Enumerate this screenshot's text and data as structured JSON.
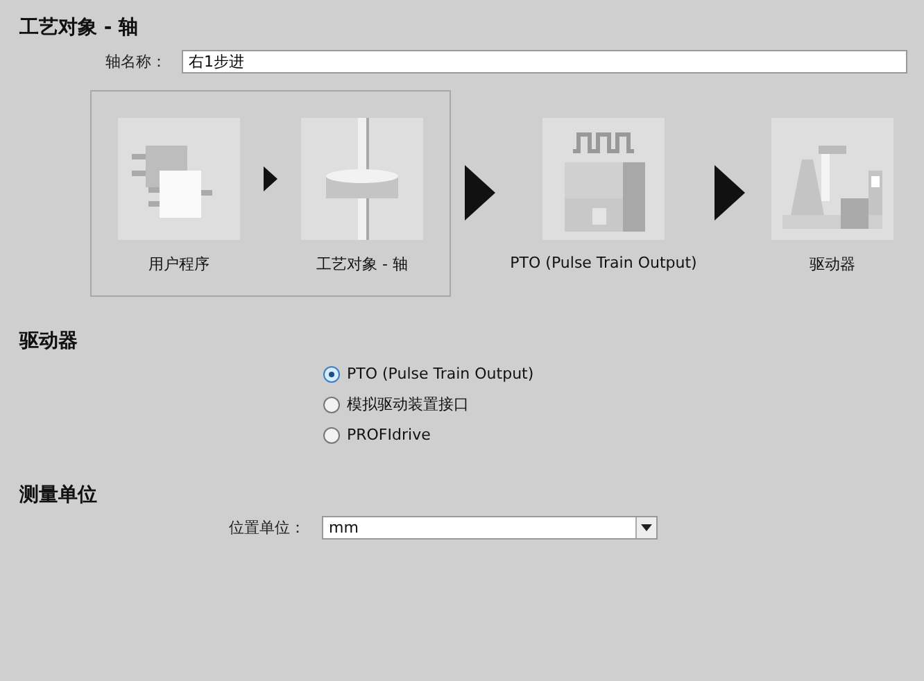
{
  "title": "工艺对象 - 轴",
  "axis_name": {
    "label": "轴名称：",
    "value": "右1步进"
  },
  "flow": {
    "group": [
      {
        "kind": "program",
        "label": "用户程序"
      },
      {
        "kind": "axis",
        "label": "工艺对象 - 轴"
      }
    ],
    "outputs": [
      {
        "kind": "pto",
        "label": "PTO (Pulse Train Output)"
      },
      {
        "kind": "drive",
        "label": "驱动器"
      }
    ]
  },
  "drive": {
    "heading": "驱动器",
    "options": [
      {
        "label": "PTO (Pulse Train Output)",
        "selected": true
      },
      {
        "label": "模拟驱动装置接口",
        "selected": false
      },
      {
        "label": "PROFIdrive",
        "selected": false
      }
    ]
  },
  "units": {
    "heading": "测量单位",
    "label": "位置单位：",
    "value": "mm"
  }
}
